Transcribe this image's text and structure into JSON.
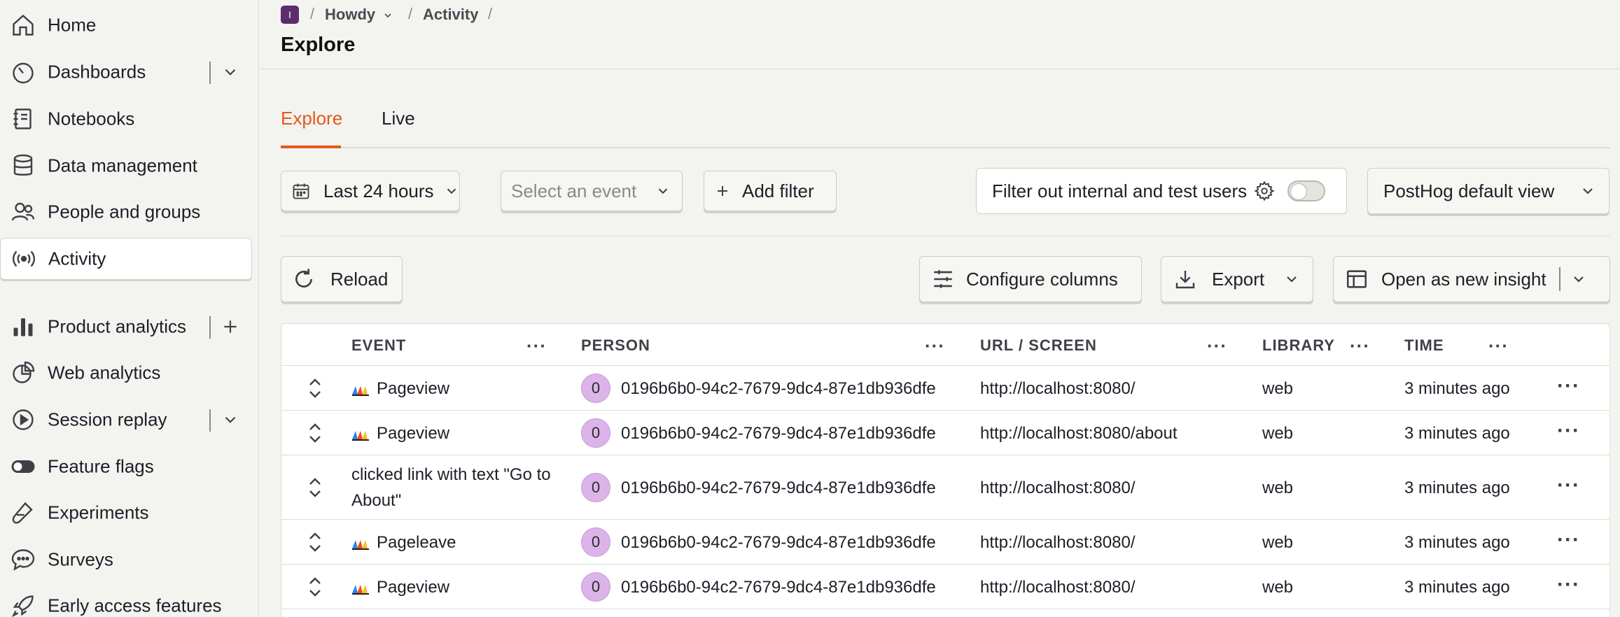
{
  "sidebar": {
    "items": [
      {
        "label": "Home",
        "icon": "home-icon"
      },
      {
        "label": "Dashboards",
        "icon": "dashboard-icon"
      },
      {
        "label": "Notebooks",
        "icon": "notebook-icon"
      },
      {
        "label": "Data management",
        "icon": "database-icon"
      },
      {
        "label": "People and groups",
        "icon": "people-icon"
      },
      {
        "label": "Activity",
        "icon": "activity-icon"
      },
      {
        "label": "Product analytics",
        "icon": "bar-chart-icon"
      },
      {
        "label": "Web analytics",
        "icon": "pie-chart-icon"
      },
      {
        "label": "Session replay",
        "icon": "replay-icon"
      },
      {
        "label": "Feature flags",
        "icon": "toggle-icon"
      },
      {
        "label": "Experiments",
        "icon": "flask-icon"
      },
      {
        "label": "Surveys",
        "icon": "chat-icon"
      },
      {
        "label": "Early access features",
        "icon": "rocket-icon"
      }
    ]
  },
  "breadcrumb": {
    "project_initial": "I",
    "project": "Howdy",
    "section": "Activity",
    "separator": "/"
  },
  "page_title": "Explore",
  "tabs": [
    {
      "label": "Explore",
      "active": true
    },
    {
      "label": "Live",
      "active": false
    }
  ],
  "filters": {
    "date_range": "Last 24 hours",
    "event_placeholder": "Select an event",
    "add_filter": "Add filter",
    "internal_users": "Filter out internal and test users",
    "view": "PostHog default view"
  },
  "actions": {
    "reload": "Reload",
    "configure_columns": "Configure columns",
    "export": "Export",
    "open_insight": "Open as new insight"
  },
  "table": {
    "columns": [
      "EVENT",
      "PERSON",
      "URL / SCREEN",
      "LIBRARY",
      "TIME"
    ],
    "more": "···",
    "rows": [
      {
        "event": "Pageview",
        "event_line2": "",
        "has_icon": true,
        "avatar": "0",
        "person": "0196b6b0-94c2-7679-9dc4-87e1db936dfe",
        "url": "http://localhost:8080/",
        "library": "web",
        "time": "3 minutes ago"
      },
      {
        "event": "Pageview",
        "event_line2": "",
        "has_icon": true,
        "avatar": "0",
        "person": "0196b6b0-94c2-7679-9dc4-87e1db936dfe",
        "url": "http://localhost:8080/about",
        "library": "web",
        "time": "3 minutes ago"
      },
      {
        "event": "clicked link with text \"Go to",
        "event_line2": "About\"",
        "has_icon": false,
        "avatar": "0",
        "person": "0196b6b0-94c2-7679-9dc4-87e1db936dfe",
        "url": "http://localhost:8080/",
        "library": "web",
        "time": "3 minutes ago"
      },
      {
        "event": "Pageleave",
        "event_line2": "",
        "has_icon": true,
        "avatar": "0",
        "person": "0196b6b0-94c2-7679-9dc4-87e1db936dfe",
        "url": "http://localhost:8080/",
        "library": "web",
        "time": "3 minutes ago"
      },
      {
        "event": "Pageview",
        "event_line2": "",
        "has_icon": true,
        "avatar": "0",
        "person": "0196b6b0-94c2-7679-9dc4-87e1db936dfe",
        "url": "http://localhost:8080/",
        "library": "web",
        "time": "3 minutes ago"
      }
    ]
  },
  "colors": {
    "accent": "#e4581d",
    "avatar": "#dcb4ea",
    "project": "#5b2d6b"
  }
}
